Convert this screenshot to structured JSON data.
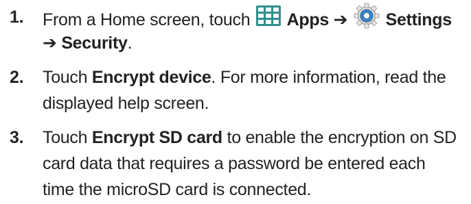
{
  "steps": [
    {
      "number": "1.",
      "parts": {
        "intro": "From a Home screen, touch",
        "apps": "Apps",
        "arrow1": "➔",
        "settings": "Settings",
        "arrow2": "➔",
        "security": "Security",
        "period": "."
      },
      "icons": [
        "apps-grid-icon",
        "settings-gear-icon"
      ]
    },
    {
      "number": "2.",
      "parts": {
        "touch": "Touch",
        "encrypt_device": "Encrypt device",
        "rest_line1": ". For more information, read the",
        "line2": "displayed help screen."
      }
    },
    {
      "number": "3.",
      "parts": {
        "touch": "Touch",
        "encrypt_sd": "Encrypt SD card",
        "rest_line1": "to enable the encryption on SD",
        "line2": "card data that requires a password be entered each",
        "line3": "time the microSD card is connected."
      }
    }
  ],
  "colors": {
    "text": "#222222",
    "apps_icon": "#2f8f8c",
    "settings_icon": "#3a86c8"
  }
}
